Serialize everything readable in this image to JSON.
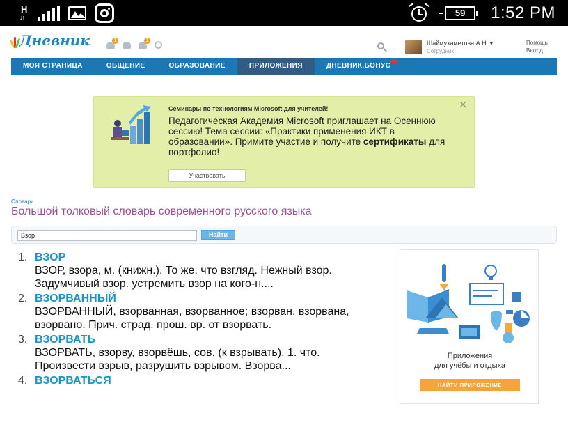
{
  "status_bar": {
    "network_indicator": "H",
    "battery_level": "59",
    "time": "1:52 PM",
    "icons": [
      "h-network-icon",
      "signal-icon",
      "gallery-icon",
      "instagram-icon",
      "alarm-icon",
      "battery-icon"
    ]
  },
  "header": {
    "logo_text": "Дневник",
    "user_name": "Шаймухаметова А.Н. ▾",
    "user_role": "Сотрудник",
    "help_link": "Помощь",
    "logout_link": "Выход",
    "notifications": [
      "1",
      "1"
    ]
  },
  "nav": {
    "items": [
      {
        "label": "МОЯ СТРАНИЦА"
      },
      {
        "label": "ОБЩЕНИЕ"
      },
      {
        "label": "ОБРАЗОВАНИЕ"
      },
      {
        "label": "ПРИЛОЖЕНИЯ"
      },
      {
        "label": "ДНЕВНИК.БОНУС"
      }
    ],
    "active_index": 3
  },
  "banner": {
    "title": "Семинары по технологиям Microsoft для учителей!",
    "text_before": "Педагогическая Академия Microsoft приглашает на Осеннюю сессию! Тема сессии: «Практики применения ИКТ в образовании». Примите участие и получите ",
    "text_bold": "сертификаты",
    "text_after": " для портфолио!",
    "button_label": "Участвовать",
    "close_label": "✕"
  },
  "dictionary": {
    "breadcrumb": "Словари",
    "title": "Большой толковый словарь современного русского языка",
    "search_value": "Взор",
    "search_button": "Найти",
    "results": [
      {
        "number": "1.",
        "headword": "ВЗОР",
        "definition": "ВЗОР, взора, м. (книжн.). То же, что взгляд. Нежный взор. Задумчивый взор. устремить взор на кого-н...."
      },
      {
        "number": "2.",
        "headword": "ВЗОРВАННЫЙ",
        "definition": "ВЗОРВАННЫЙ, взорванная, взорванное; взорван, взорвана, взорвано. Прич. страд. прош. вр. от взорвать."
      },
      {
        "number": "3.",
        "headword": "ВЗОРВАТЬ",
        "definition": "ВЗОРВАТЬ, взорву, взорвёшь, сов. (к взрывать). 1. что. Произвести взрыв, разрушить взрывом. Взорва..."
      },
      {
        "number": "4.",
        "headword": "ВЗОРВАТЬСЯ",
        "definition": ""
      }
    ]
  },
  "ad": {
    "line1": "Приложения",
    "line2": "для учёбы и отдыха",
    "button_label": "НАЙТИ ПРИЛОЖЕНИЕ"
  },
  "colors": {
    "nav_bg": "#1b78b4",
    "nav_active": "#2f5d86",
    "banner_bg": "#e3efa8",
    "headword": "#1a95c9",
    "title": "#9b4f8f",
    "ad_button": "#f6a43a"
  }
}
